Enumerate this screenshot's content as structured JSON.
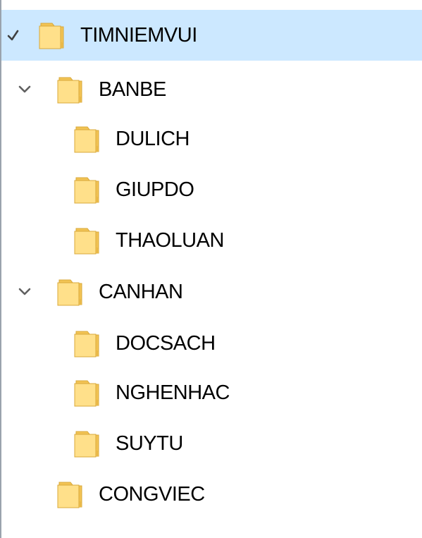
{
  "tree": {
    "root": {
      "label": "TIMNIEMVUI",
      "icon": "folder-icon",
      "expanded": true,
      "selected": true
    },
    "banbe": {
      "label": "BANBE",
      "icon": "folder-icon",
      "expanded": true,
      "children": [
        {
          "label": "DULICH",
          "icon": "folder-icon"
        },
        {
          "label": "GIUPDO",
          "icon": "folder-icon"
        },
        {
          "label": "THAOLUAN",
          "icon": "folder-icon"
        }
      ]
    },
    "canhan": {
      "label": "CANHAN",
      "icon": "folder-icon",
      "expanded": true,
      "children": [
        {
          "label": "DOCSACH",
          "icon": "folder-icon"
        },
        {
          "label": "NGHENHAC",
          "icon": "folder-icon"
        },
        {
          "label": "SUYTU",
          "icon": "folder-icon"
        }
      ]
    },
    "congviec": {
      "label": "CONGVIEC",
      "icon": "folder-icon",
      "expanded": false
    }
  },
  "colors": {
    "selection": "#cce8ff",
    "folder_front": "#ffe08a",
    "folder_back": "#f2c354",
    "folder_edge": "#d8a83a"
  }
}
